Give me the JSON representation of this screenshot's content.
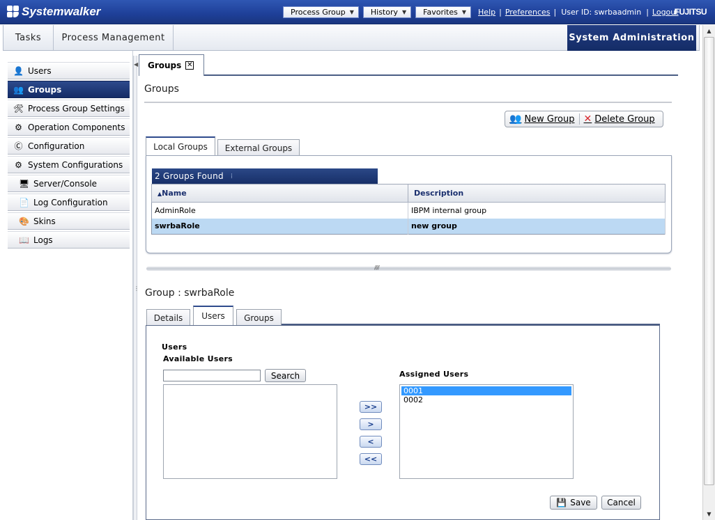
{
  "app": {
    "brand": "Systemwalker",
    "vendor": "FUJITSU"
  },
  "topnav": {
    "dropdowns": [
      "Process Group",
      "History",
      "Favorites"
    ],
    "help": "Help",
    "preferences": "Preferences",
    "user_id": "User ID: swrbaadmin",
    "logout": "Logout"
  },
  "main_tabs": {
    "tasks": "Tasks",
    "process_management": "Process Management",
    "system_administration": "System Administration"
  },
  "sidebar": {
    "items": [
      {
        "label": "Users",
        "icon": "user-icon"
      },
      {
        "label": "Groups",
        "icon": "group-icon",
        "active": true
      },
      {
        "label": "Process Group Settings",
        "icon": "tools-icon"
      },
      {
        "label": "Operation Components",
        "icon": "gear-icon"
      },
      {
        "label": "Configuration",
        "icon": "config-icon"
      },
      {
        "label": "System Configurations",
        "icon": "gears-icon"
      },
      {
        "label": "Server/Console",
        "icon": "server-icon",
        "sub": true
      },
      {
        "label": "Log Configuration",
        "icon": "log-config-icon",
        "sub": true
      },
      {
        "label": "Skins",
        "icon": "skins-icon",
        "sub": true
      },
      {
        "label": "Logs",
        "icon": "logs-icon",
        "sub": true
      }
    ]
  },
  "content_tab": {
    "label": "Groups"
  },
  "groups_page": {
    "title": "Groups",
    "new_group": "New Group",
    "delete_group": "Delete Group",
    "tabs": [
      "Local Groups",
      "External Groups"
    ],
    "found": "2 Groups Found",
    "columns": [
      "Name",
      "Description"
    ],
    "rows": [
      {
        "name": "AdminRole",
        "description": "IBPM internal group"
      },
      {
        "name": "swrbaRole",
        "description": "new group",
        "selected": true
      }
    ]
  },
  "group_detail": {
    "title": "Group : swrbaRole",
    "tabs": [
      "Details",
      "Users",
      "Groups"
    ],
    "users_heading": "Users",
    "available_users": "Available Users",
    "search_button": "Search",
    "search_value": "",
    "assigned_users": "Assigned Users",
    "assigned_list": [
      "0001",
      "0002"
    ],
    "move_buttons": [
      ">>",
      ">",
      "<",
      "<<"
    ],
    "save": "Save",
    "cancel": "Cancel"
  }
}
